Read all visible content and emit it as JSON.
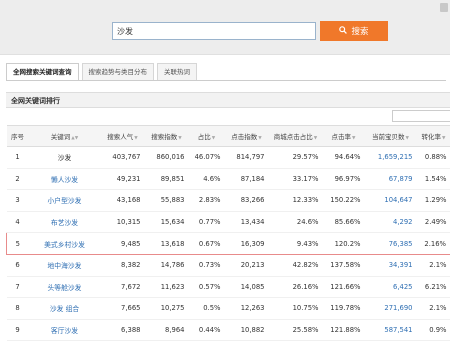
{
  "search": {
    "value": "沙发",
    "button_label": "搜索",
    "button_icon": "magnifier-icon"
  },
  "tabs": [
    {
      "label": "全网搜索关键词查询",
      "active": true
    },
    {
      "label": "搜索趋势与类目分布",
      "active": false
    },
    {
      "label": "关联热词",
      "active": false
    }
  ],
  "panel_title": "全网关键词排行",
  "table": {
    "headers": [
      "序号",
      "关键词",
      "搜索人气",
      "搜索指数",
      "占比",
      "点击指数",
      "商城点击占比",
      "点击率",
      "当前宝贝数",
      "转化率"
    ],
    "rows": [
      {
        "idx": "1",
        "kw": "沙发",
        "pop": "403,767",
        "sidx": "860,016",
        "share": "46.07%",
        "cidx": "814,797",
        "mall": "29.57%",
        "ctr": "94.64%",
        "items": "1,659,215",
        "conv": "0.88%"
      },
      {
        "idx": "2",
        "kw": "懒人沙发",
        "pop": "49,231",
        "sidx": "89,851",
        "share": "4.6%",
        "cidx": "87,184",
        "mall": "33.17%",
        "ctr": "96.97%",
        "items": "67,879",
        "conv": "1.54%"
      },
      {
        "idx": "3",
        "kw": "小户型沙发",
        "pop": "43,168",
        "sidx": "55,883",
        "share": "2.83%",
        "cidx": "83,266",
        "mall": "12.33%",
        "ctr": "150.22%",
        "items": "104,647",
        "conv": "1.29%"
      },
      {
        "idx": "4",
        "kw": "布艺沙发",
        "pop": "10,315",
        "sidx": "15,634",
        "share": "0.77%",
        "cidx": "13,434",
        "mall": "24.6%",
        "ctr": "85.66%",
        "items": "4,292",
        "conv": "2.49%"
      },
      {
        "idx": "5",
        "kw": "美式乡村沙发",
        "pop": "9,485",
        "sidx": "13,618",
        "share": "0.67%",
        "cidx": "16,309",
        "mall": "9.43%",
        "ctr": "120.2%",
        "items": "76,385",
        "conv": "2.16%"
      },
      {
        "idx": "6",
        "kw": "地中海沙发",
        "pop": "8,382",
        "sidx": "14,786",
        "share": "0.73%",
        "cidx": "20,213",
        "mall": "42.82%",
        "ctr": "137.58%",
        "items": "34,391",
        "conv": "2.1%"
      },
      {
        "idx": "7",
        "kw": "头等舱沙发",
        "pop": "7,672",
        "sidx": "11,623",
        "share": "0.57%",
        "cidx": "14,085",
        "mall": "26.16%",
        "ctr": "121.66%",
        "items": "6,425",
        "conv": "6.21%"
      },
      {
        "idx": "8",
        "kw": "沙发 组合",
        "pop": "7,665",
        "sidx": "10,275",
        "share": "0.5%",
        "cidx": "12,263",
        "mall": "10.75%",
        "ctr": "119.78%",
        "items": "271,690",
        "conv": "2.1%"
      },
      {
        "idx": "9",
        "kw": "客厅沙发",
        "pop": "6,388",
        "sidx": "8,964",
        "share": "0.44%",
        "cidx": "10,882",
        "mall": "25.58%",
        "ctr": "121.88%",
        "items": "587,541",
        "conv": "0.9%"
      }
    ],
    "highlighted_row_index": 5
  },
  "colors": {
    "accent": "#f0782a",
    "link": "#2f6fb3",
    "highlight_border": "#e88b8b"
  }
}
